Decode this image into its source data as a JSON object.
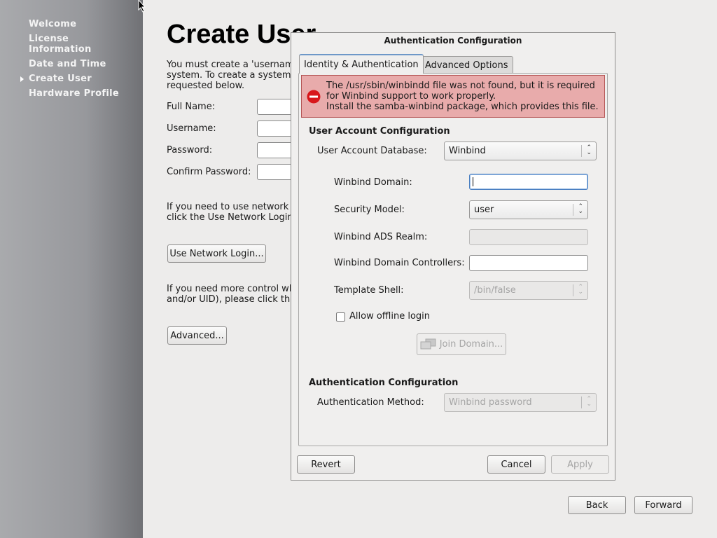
{
  "sidebar": {
    "items": [
      {
        "label": "Welcome"
      },
      {
        "label": "License Information"
      },
      {
        "label": "Date and Time"
      },
      {
        "label": "Create User",
        "current": true
      },
      {
        "label": "Hardware Profile"
      }
    ]
  },
  "main": {
    "title": "Create User",
    "intro": "You must create a 'usernam system.  To create a system requested below.",
    "intro_lines": [
      "You must create a 'usernam",
      "system.  To create a system",
      "requested below."
    ],
    "fields": [
      {
        "label": "Full Name:",
        "value": ""
      },
      {
        "label": "Username:",
        "value": ""
      },
      {
        "label": "Password:",
        "value": ""
      },
      {
        "label": "Confirm Password:",
        "value": ""
      }
    ],
    "network_text": [
      "If you need to use network a",
      "click the Use Network Login"
    ],
    "network_button": "Use Network Login...",
    "advanced_text": [
      "If you need more control wh",
      "and/or UID), please click the"
    ],
    "advanced_button": "Advanced...",
    "back_button": "Back",
    "forward_button": "Forward"
  },
  "dialog": {
    "title": "Authentication Configuration",
    "tabs": [
      {
        "label": "Identity & Authentication",
        "active": true
      },
      {
        "label": "Advanced Options"
      }
    ],
    "alert": {
      "icon": "error-icon",
      "lines": [
        "The /usr/sbin/winbindd file was not found, but it is required",
        "for Winbind support to work properly.",
        "Install the samba-winbind package, which provides this file."
      ]
    },
    "user_account_section": "User Account Configuration",
    "user_account_db_label": "User Account Database:",
    "user_account_db_value": "Winbind",
    "winbind_domain_label": "Winbind Domain:",
    "winbind_domain_value": "",
    "security_model_label": "Security Model:",
    "security_model_value": "user",
    "ads_realm_label": "Winbind ADS Realm:",
    "ads_realm_value": "",
    "domain_controllers_label": "Winbind Domain Controllers:",
    "domain_controllers_value": "",
    "template_shell_label": "Template Shell:",
    "template_shell_value": "/bin/false",
    "offline_login_label": "Allow offline login",
    "offline_login_checked": false,
    "join_domain_button": "Join Domain...",
    "auth_section": "Authentication Configuration",
    "auth_method_label": "Authentication Method:",
    "auth_method_value": "Winbind password",
    "revert_button": "Revert",
    "cancel_button": "Cancel",
    "apply_button": "Apply"
  }
}
